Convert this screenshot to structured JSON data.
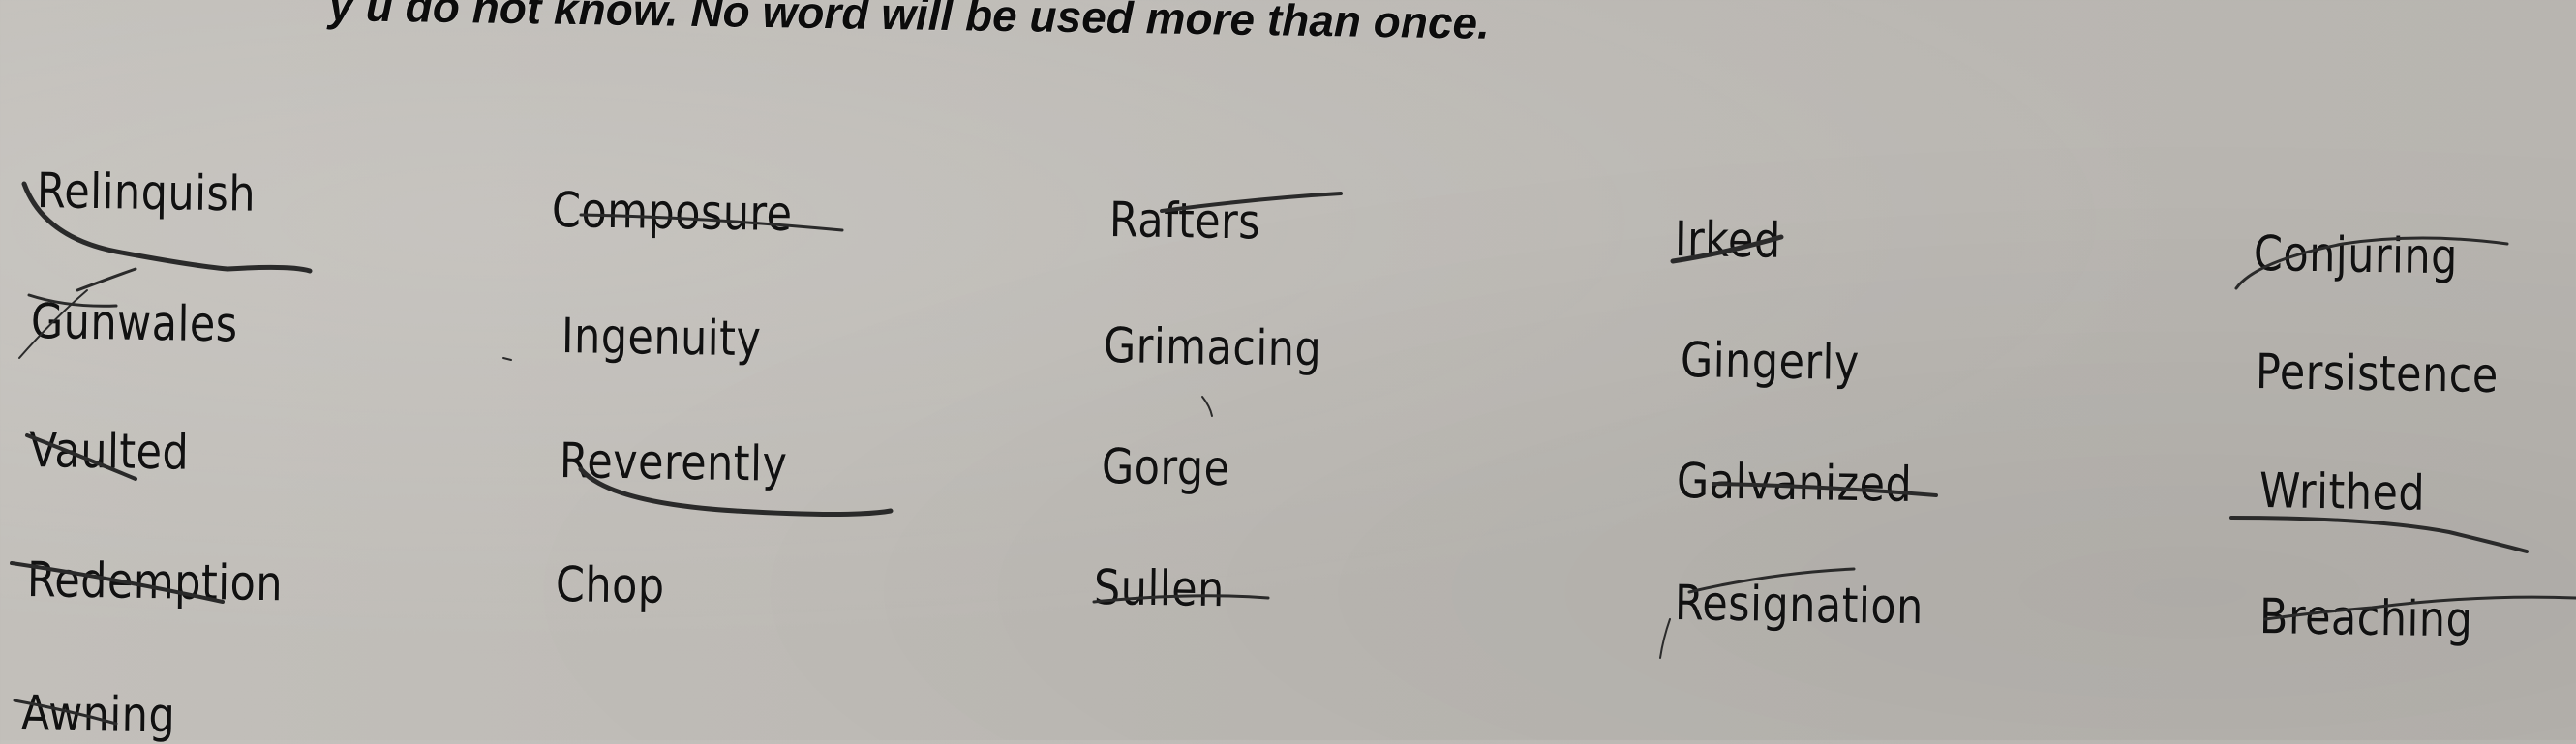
{
  "instructions": {
    "visible_text": "y  u do not know. No word will be used more than once."
  },
  "word_bank": {
    "columns": [
      {
        "words": [
          {
            "text": "Relinquish",
            "pen_mark": "squiggle-under"
          },
          {
            "text": "Gunwales",
            "pen_mark": "slash"
          },
          {
            "text": "Vaulted",
            "pen_mark": "strikethrough"
          },
          {
            "text": "Redemption",
            "pen_mark": "strikethrough"
          },
          {
            "text": "Awning",
            "pen_mark": "strikethrough"
          }
        ]
      },
      {
        "words": [
          {
            "text": "Composure",
            "pen_mark": "strikethrough"
          },
          {
            "text": "Ingenuity",
            "pen_mark": "none"
          },
          {
            "text": "Reverently",
            "pen_mark": "underline"
          },
          {
            "text": "Chop",
            "pen_mark": "none"
          }
        ]
      },
      {
        "words": [
          {
            "text": "Rafters",
            "pen_mark": "overline"
          },
          {
            "text": "Grimacing",
            "pen_mark": "none"
          },
          {
            "text": "Gorge",
            "pen_mark": "none"
          },
          {
            "text": "Sullen",
            "pen_mark": "strikethrough"
          }
        ]
      },
      {
        "words": [
          {
            "text": "Irked",
            "pen_mark": "strikethrough"
          },
          {
            "text": "Gingerly",
            "pen_mark": "none"
          },
          {
            "text": "Galvanized",
            "pen_mark": "strikethrough"
          },
          {
            "text": "Resignation",
            "pen_mark": "overline"
          }
        ]
      },
      {
        "words": [
          {
            "text": "Conjuring",
            "pen_mark": "strikethrough"
          },
          {
            "text": "Persistence",
            "pen_mark": "none"
          },
          {
            "text": "Writhed",
            "pen_mark": "underline"
          },
          {
            "text": "Breaching",
            "pen_mark": "strikethrough"
          }
        ]
      }
    ]
  },
  "colors": {
    "paper": "#bdbab5",
    "ink": "#111111",
    "pen": "#2a2a2a"
  }
}
